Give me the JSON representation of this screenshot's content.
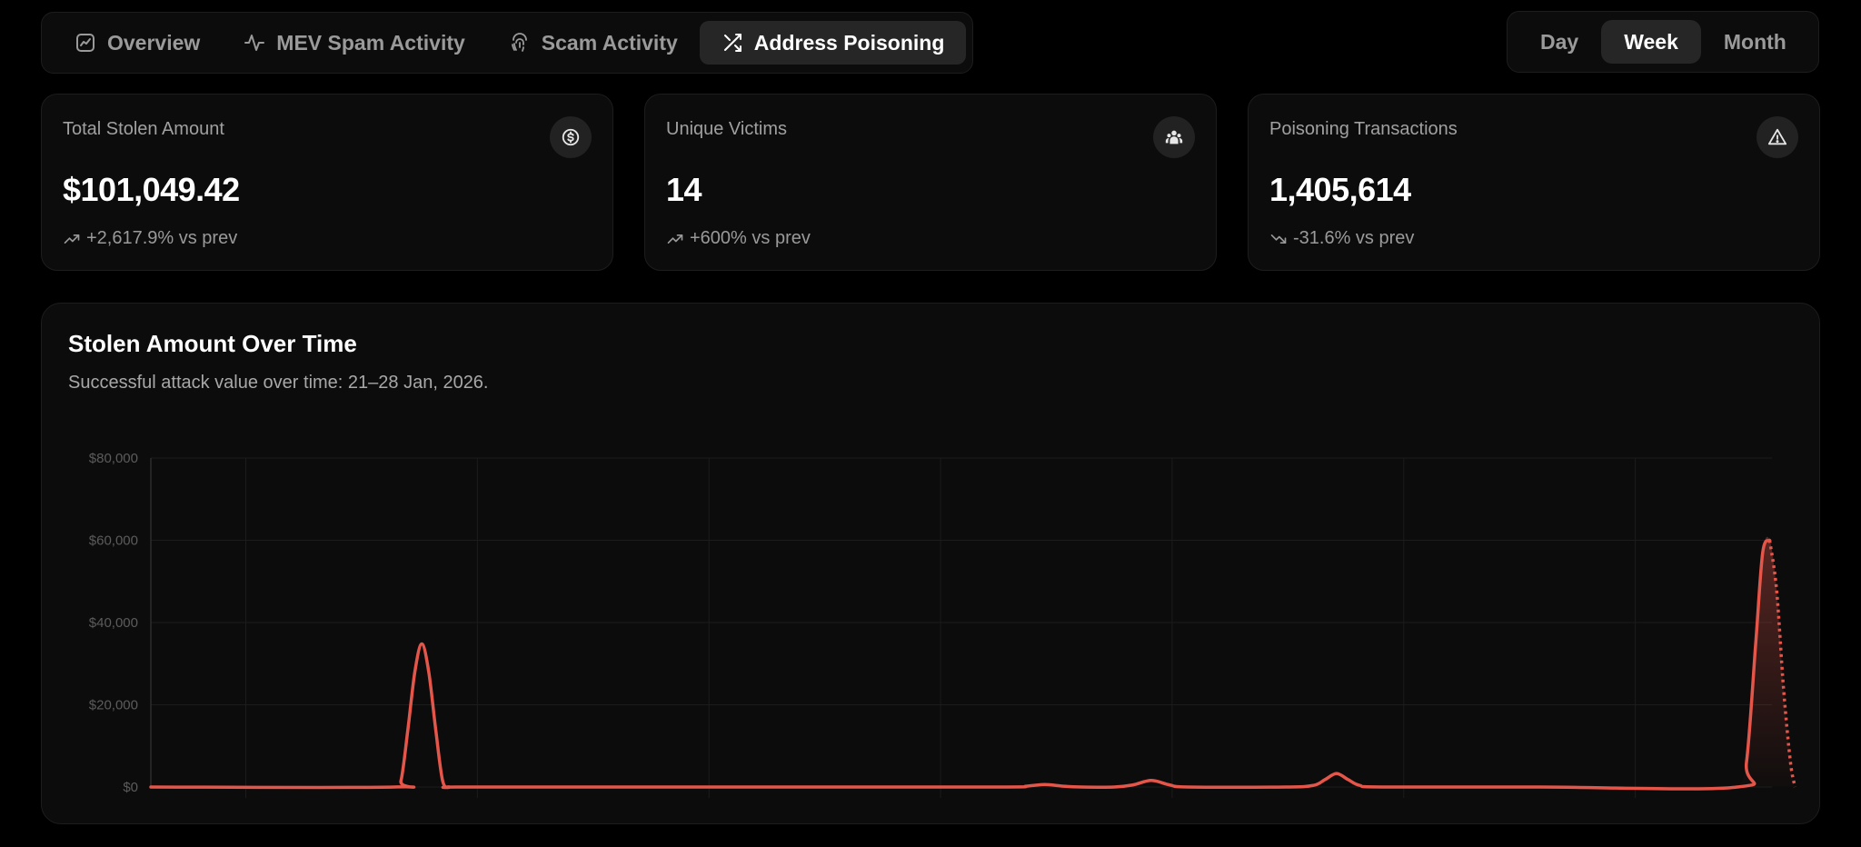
{
  "nav": {
    "tabs": [
      {
        "label": "Overview",
        "icon": "chart-line-icon",
        "active": false
      },
      {
        "label": "MEV Spam Activity",
        "icon": "activity-icon",
        "active": false
      },
      {
        "label": "Scam Activity",
        "icon": "fingerprint-icon",
        "active": false
      },
      {
        "label": "Address Poisoning",
        "icon": "shuffle-icon",
        "active": true
      }
    ]
  },
  "range": {
    "options": [
      "Day",
      "Week",
      "Month"
    ],
    "selected": "Week"
  },
  "stats": [
    {
      "label": "Total Stolen Amount",
      "value": "$101,049.42",
      "change": "+2,617.9% vs prev",
      "trend": "up",
      "icon": "dollar-icon"
    },
    {
      "label": "Unique Victims",
      "value": "14",
      "change": "+600% vs prev",
      "trend": "up",
      "icon": "users-icon"
    },
    {
      "label": "Poisoning Transactions",
      "value": "1,405,614",
      "change": "-31.6% vs prev",
      "trend": "down",
      "icon": "alert-triangle-icon"
    }
  ],
  "chart": {
    "title": "Stolen Amount Over Time",
    "subtitle": "Successful attack value over time: 21–28 Jan, 2026."
  },
  "chart_data": {
    "type": "area",
    "x_domain": [
      0,
      7
    ],
    "ylim": [
      0,
      80000
    ],
    "yticks": [
      "$0",
      "$20,000",
      "$40,000",
      "$60,000",
      "$80,000"
    ],
    "ytick_values": [
      0,
      20000,
      40000,
      60000,
      80000
    ],
    "grid": true,
    "colors": {
      "line": "#e5564a",
      "grid": "#1c1c1c",
      "axis": "#2c2c2c"
    },
    "series": [
      {
        "x": [
          0,
          1.05,
          1.08,
          1.11,
          1.14,
          1.17,
          1.2,
          1.23,
          1.26,
          1.29,
          1.32,
          2.0,
          3.0,
          3.7,
          3.78,
          3.86,
          3.94,
          4.02,
          4.16,
          4.24,
          4.32,
          4.4,
          4.48,
          4.9,
          5.02,
          5.07,
          5.12,
          5.17,
          5.22,
          5.32,
          6.0,
          6.85,
          6.89,
          6.93,
          6.96,
          6.99
        ],
        "y": [
          0,
          0,
          1500,
          14000,
          28000,
          34800,
          28000,
          14000,
          1500,
          0,
          0,
          0,
          0,
          0,
          200,
          600,
          200,
          0,
          0,
          500,
          1600,
          500,
          0,
          0,
          400,
          1800,
          3300,
          1800,
          400,
          0,
          0,
          0,
          6000,
          35000,
          57000,
          60000
        ],
        "projected": {
          "x": [
            6.99,
            7.02,
            7.05,
            7.08,
            7.1
          ],
          "y": [
            60000,
            48000,
            24000,
            6000,
            0
          ]
        }
      }
    ]
  }
}
